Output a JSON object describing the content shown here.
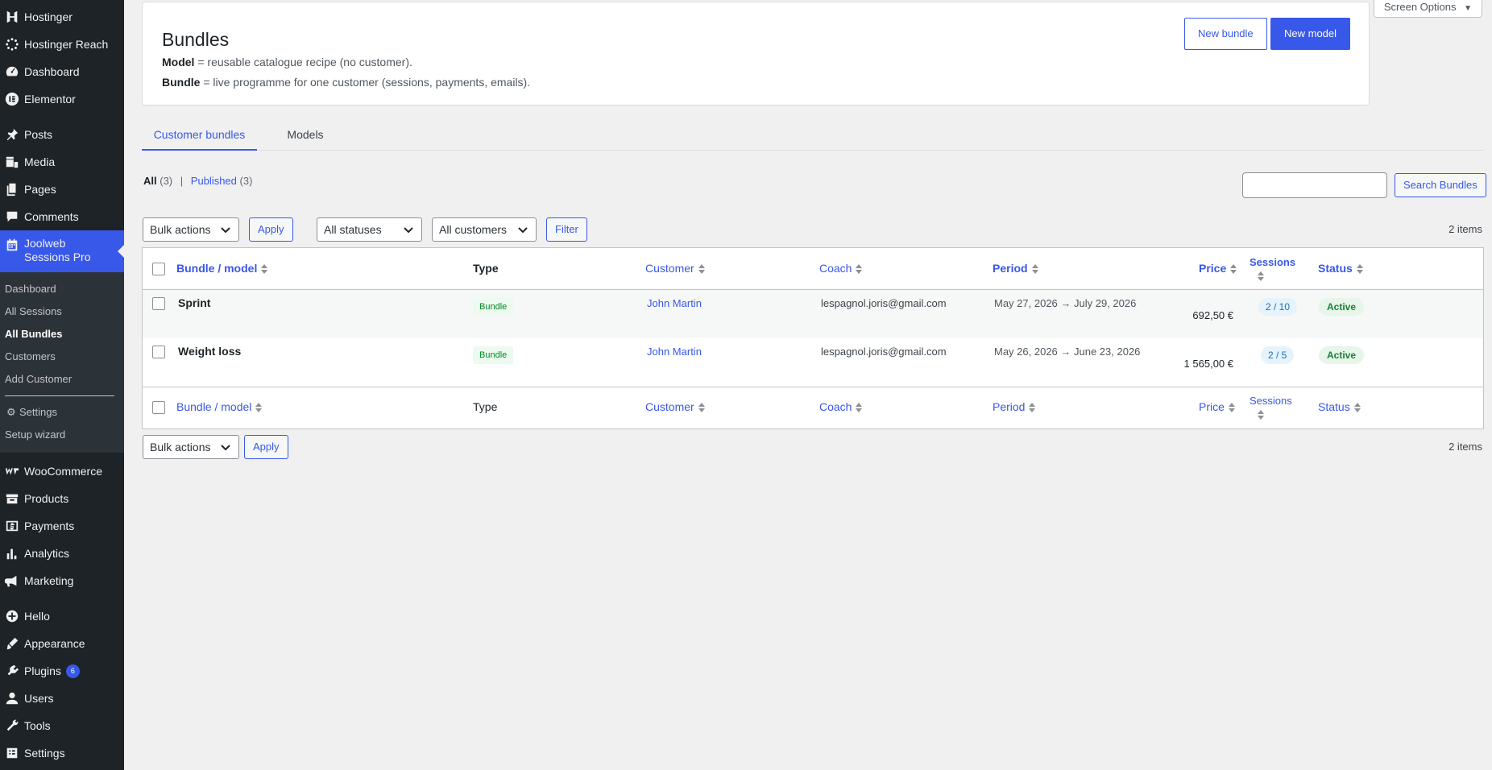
{
  "sidebar": {
    "top_items": [
      {
        "label": "Hostinger",
        "icon": "hostinger-icon"
      },
      {
        "label": "Hostinger Reach",
        "icon": "reach-icon"
      },
      {
        "label": "Dashboard",
        "icon": "dashboard-icon"
      },
      {
        "label": "Elementor",
        "icon": "elementor-icon"
      }
    ],
    "content_items": [
      {
        "label": "Posts",
        "icon": "pin-icon"
      },
      {
        "label": "Media",
        "icon": "media-icon"
      },
      {
        "label": "Pages",
        "icon": "pages-icon"
      },
      {
        "label": "Comments",
        "icon": "comments-icon"
      }
    ],
    "current": {
      "label": "Joolweb Sessions Pro",
      "icon": "calendar-icon"
    },
    "submenu": {
      "dashboard": "Dashboard",
      "all_sessions": "All Sessions",
      "all_bundles": "All Bundles",
      "customers": "Customers",
      "add_customer": "Add Customer",
      "settings": "Settings",
      "setup_wizard": "Setup wizard"
    },
    "commerce_items": [
      {
        "label": "WooCommerce",
        "icon": "woo-icon"
      },
      {
        "label": "Products",
        "icon": "products-icon"
      },
      {
        "label": "Payments",
        "icon": "payments-icon"
      },
      {
        "label": "Analytics",
        "icon": "analytics-icon"
      },
      {
        "label": "Marketing",
        "icon": "marketing-icon"
      }
    ],
    "bottom_items": [
      {
        "label": "Hello",
        "icon": "plus-circle-icon"
      },
      {
        "label": "Appearance",
        "icon": "brush-icon"
      },
      {
        "label": "Plugins",
        "icon": "plugins-icon",
        "badge": "6"
      },
      {
        "label": "Users",
        "icon": "users-icon"
      },
      {
        "label": "Tools",
        "icon": "wrench-icon"
      },
      {
        "label": "Settings",
        "icon": "settings-icon"
      }
    ]
  },
  "screen_options": "Screen Options",
  "header": {
    "title": "Bundles",
    "desc1_key": "Model",
    "desc1_rest": " = reusable catalogue recipe (no customer).",
    "desc2_key": "Bundle",
    "desc2_rest": " = live programme for one customer (sessions, payments, emails).",
    "new_bundle": "New bundle",
    "new_model": "New model"
  },
  "tabs": {
    "customer_bundles": "Customer bundles",
    "models": "Models"
  },
  "views": {
    "all": "All",
    "all_count": "(3)",
    "sep": "|",
    "published": "Published",
    "published_count": "(3)"
  },
  "search": {
    "button": "Search Bundles",
    "value": ""
  },
  "filters": {
    "bulk_actions": "Bulk actions",
    "apply": "Apply",
    "statuses": "All statuses",
    "customers": "All customers",
    "filter": "Filter",
    "items_count": "2 items"
  },
  "table": {
    "columns": {
      "bundle": "Bundle / model",
      "type": "Type",
      "customer": "Customer",
      "coach": "Coach",
      "period": "Period",
      "price": "Price",
      "sessions": "Sessions",
      "status": "Status"
    },
    "rows": [
      {
        "title": "Sprint",
        "type": "Bundle",
        "customer": "John Martin",
        "coach": "lespagnol.joris@gmail.com",
        "period": "May 27, 2026 → July 29, 2026",
        "price": "692,50 €",
        "sessions": "2 / 10",
        "status": "Active"
      },
      {
        "title": "Weight loss",
        "type": "Bundle",
        "customer": "John Martin",
        "coach": "lespagnol.joris@gmail.com",
        "period": "May 26, 2026 → June 23, 2026",
        "price": "1 565,00 €",
        "sessions": "2 / 5",
        "status": "Active"
      }
    ]
  },
  "bottom": {
    "bulk_actions": "Bulk actions",
    "apply": "Apply",
    "items_count": "2 items"
  },
  "colors": {
    "accent": "#3858e9",
    "sidebar": "#1d2327",
    "active_green": "#1a7f37"
  }
}
